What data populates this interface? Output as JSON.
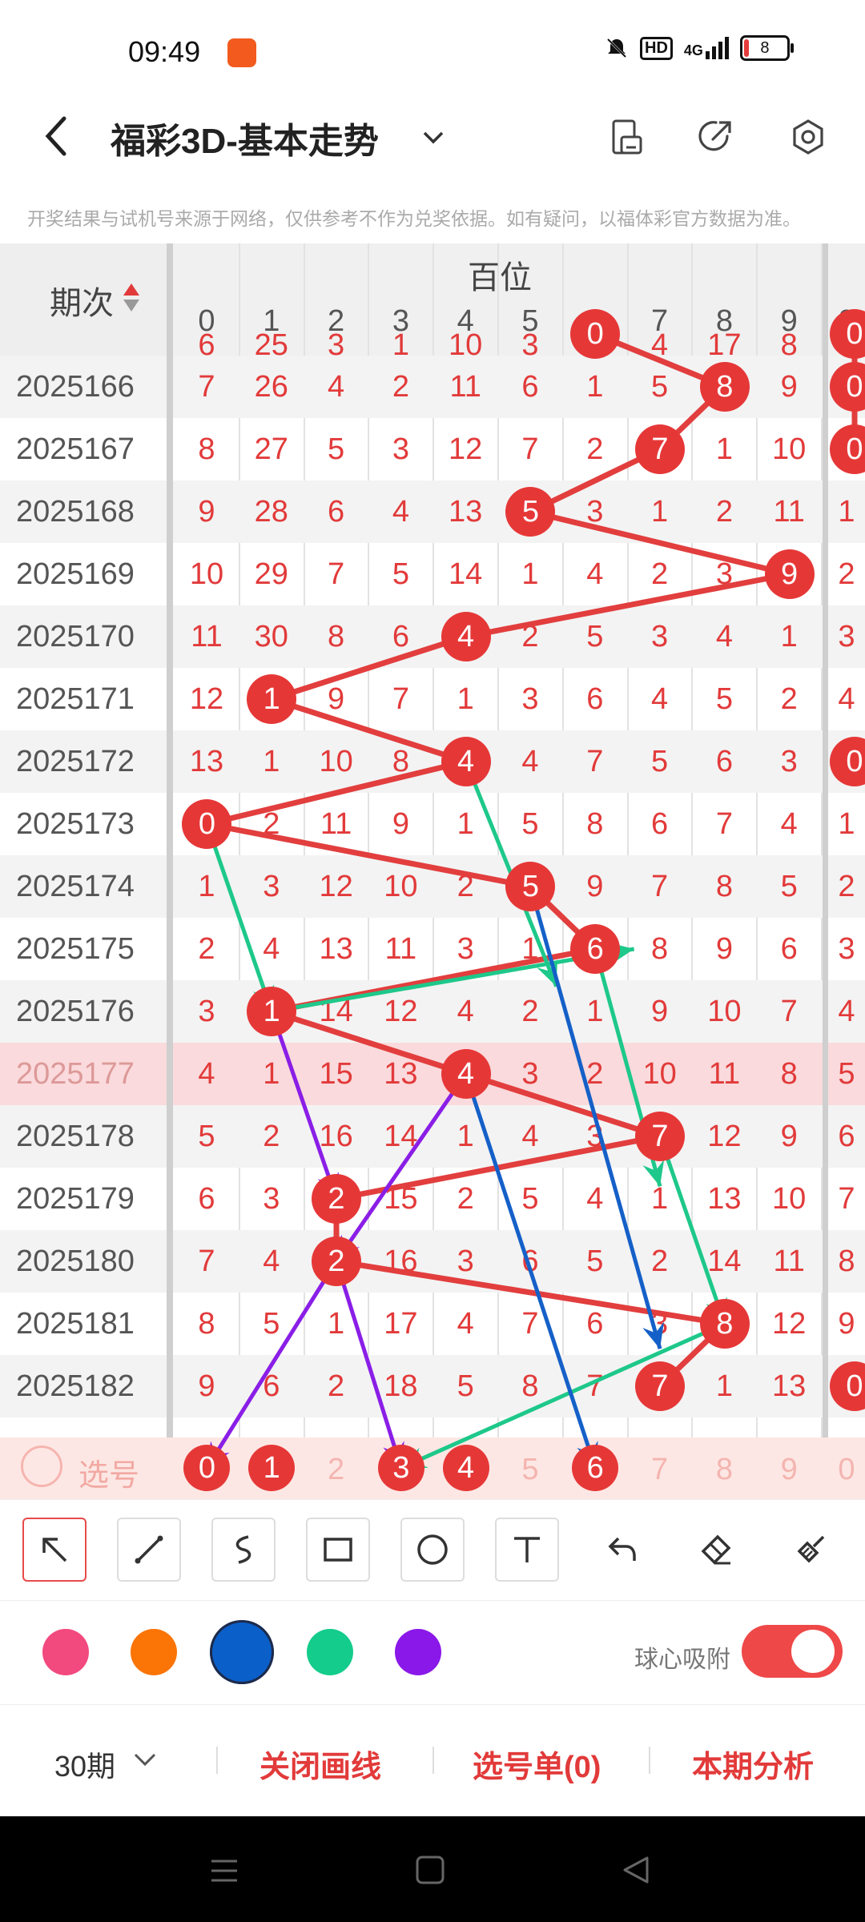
{
  "status": {
    "time": "09:49",
    "network": "4G",
    "hd": "HD",
    "battery": "8"
  },
  "header": {
    "title": "福彩3D-基本走势"
  },
  "disclaimer": "开奖结果与试机号来源于网络，仅供参考不作为兑奖依据。如有疑问，以福体彩官方数据为准。",
  "table": {
    "period_header": "期次",
    "group_header": "百位",
    "digits": [
      "0",
      "1",
      "2",
      "3",
      "4",
      "5",
      "6",
      "7",
      "8",
      "9"
    ],
    "next_col_digit": "0",
    "partial_row": [
      "6",
      "25",
      "3",
      "1",
      "10",
      "3",
      "0",
      "4",
      "17",
      "8"
    ],
    "rows": [
      {
        "period": "2025166",
        "cells": [
          "7",
          "26",
          "4",
          "2",
          "11",
          "6",
          "1",
          "5",
          "8",
          "9"
        ],
        "win": 8,
        "next": "0",
        "next_ball": true
      },
      {
        "period": "2025167",
        "cells": [
          "8",
          "27",
          "5",
          "3",
          "12",
          "7",
          "2",
          "7",
          "1",
          "10"
        ],
        "win": 7,
        "next": "0",
        "next_ball": true
      },
      {
        "period": "2025168",
        "cells": [
          "9",
          "28",
          "6",
          "4",
          "13",
          "5",
          "3",
          "1",
          "2",
          "11"
        ],
        "win": 5,
        "next": "1",
        "next_ball": false
      },
      {
        "period": "2025169",
        "cells": [
          "10",
          "29",
          "7",
          "5",
          "14",
          "1",
          "4",
          "2",
          "3",
          "9"
        ],
        "win": 9,
        "next": "2",
        "next_ball": false
      },
      {
        "period": "2025170",
        "cells": [
          "11",
          "30",
          "8",
          "6",
          "4",
          "2",
          "5",
          "3",
          "4",
          "1"
        ],
        "win": 4,
        "next": "3",
        "next_ball": false
      },
      {
        "period": "2025171",
        "cells": [
          "12",
          "1",
          "9",
          "7",
          "1",
          "3",
          "6",
          "4",
          "5",
          "2"
        ],
        "win": 1,
        "next": "4",
        "next_ball": false
      },
      {
        "period": "2025172",
        "cells": [
          "13",
          "1",
          "10",
          "8",
          "4",
          "4",
          "7",
          "5",
          "6",
          "3"
        ],
        "win": 4,
        "next": "0",
        "next_ball": true
      },
      {
        "period": "2025173",
        "cells": [
          "0",
          "2",
          "11",
          "9",
          "1",
          "5",
          "8",
          "6",
          "7",
          "4"
        ],
        "win": 0,
        "next": "1",
        "next_ball": false
      },
      {
        "period": "2025174",
        "cells": [
          "1",
          "3",
          "12",
          "10",
          "2",
          "5",
          "9",
          "7",
          "8",
          "5"
        ],
        "win": 5,
        "next": "2",
        "next_ball": false
      },
      {
        "period": "2025175",
        "cells": [
          "2",
          "4",
          "13",
          "11",
          "3",
          "1",
          "6",
          "8",
          "9",
          "6"
        ],
        "win": 6,
        "next": "3",
        "next_ball": false
      },
      {
        "period": "2025176",
        "cells": [
          "3",
          "1",
          "14",
          "12",
          "4",
          "2",
          "1",
          "9",
          "10",
          "7"
        ],
        "win": 1,
        "next": "4",
        "next_ball": false
      },
      {
        "period": "2025177",
        "cells": [
          "4",
          "1",
          "15",
          "13",
          "4",
          "3",
          "2",
          "10",
          "11",
          "8"
        ],
        "win": 4,
        "next": "5",
        "next_ball": false,
        "highlight": true
      },
      {
        "period": "2025178",
        "cells": [
          "5",
          "2",
          "16",
          "14",
          "1",
          "4",
          "3",
          "7",
          "12",
          "9"
        ],
        "win": 7,
        "next": "6",
        "next_ball": false
      },
      {
        "period": "2025179",
        "cells": [
          "6",
          "3",
          "2",
          "15",
          "2",
          "5",
          "4",
          "1",
          "13",
          "10"
        ],
        "win": 2,
        "next": "7",
        "next_ball": false
      },
      {
        "period": "2025180",
        "cells": [
          "7",
          "4",
          "2",
          "16",
          "3",
          "6",
          "5",
          "2",
          "14",
          "11"
        ],
        "win": 2,
        "next": "8",
        "next_ball": false
      },
      {
        "period": "2025181",
        "cells": [
          "8",
          "5",
          "1",
          "17",
          "4",
          "7",
          "6",
          "3",
          "8",
          "12"
        ],
        "win": 8,
        "next": "9",
        "next_ball": false
      },
      {
        "period": "2025182",
        "cells": [
          "9",
          "6",
          "2",
          "18",
          "5",
          "8",
          "7",
          "7",
          "1",
          "13"
        ],
        "win": 7,
        "next": "0",
        "next_ball": true
      }
    ],
    "select_row": {
      "label": "选号",
      "cells": [
        {
          "d": "0",
          "selected": true
        },
        {
          "d": "1",
          "selected": true
        },
        {
          "d": "2",
          "selected": false
        },
        {
          "d": "3",
          "selected": true
        },
        {
          "d": "4",
          "selected": true
        },
        {
          "d": "5",
          "selected": false
        },
        {
          "d": "6",
          "selected": true
        },
        {
          "d": "7",
          "selected": false
        },
        {
          "d": "8",
          "selected": false
        },
        {
          "d": "9",
          "selected": false
        }
      ],
      "next": "0"
    }
  },
  "drawing": {
    "colors": {
      "red": "#e23e3e",
      "green": "#1ec88a",
      "purple": "#8a1ee6",
      "blue": "#1560c8"
    },
    "lines": [
      {
        "color": "green",
        "from": [
          4,
          6
        ],
        "to": [
          5.4,
          9.6
        ]
      },
      {
        "color": "green",
        "from": [
          0,
          7
        ],
        "to": [
          1,
          10
        ]
      },
      {
        "color": "green",
        "from": [
          1,
          10
        ],
        "to": [
          6.6,
          9
        ]
      },
      {
        "color": "green",
        "from": [
          6,
          9
        ],
        "to": [
          7,
          12.8
        ]
      },
      {
        "color": "green",
        "from": [
          7,
          12
        ],
        "to": [
          8,
          15
        ]
      },
      {
        "color": "green",
        "from": [
          8,
          15
        ],
        "to": [
          3,
          17
        ]
      },
      {
        "color": "purple",
        "from": [
          1,
          10
        ],
        "to": [
          2,
          13
        ]
      },
      {
        "color": "purple",
        "from": [
          4,
          11
        ],
        "to": [
          2,
          14
        ]
      },
      {
        "color": "purple",
        "from": [
          2,
          14
        ],
        "to": [
          0,
          17
        ]
      },
      {
        "color": "purple",
        "from": [
          2,
          14
        ],
        "to": [
          3,
          17
        ]
      },
      {
        "color": "blue",
        "from": [
          5,
          8
        ],
        "to": [
          7,
          15.4
        ]
      },
      {
        "color": "blue",
        "from": [
          4,
          11
        ],
        "to": [
          6,
          17
        ]
      }
    ]
  },
  "tools": [
    "pointer-tool",
    "line-tool",
    "curve-tool",
    "rectangle-tool",
    "circle-tool",
    "text-tool",
    "undo",
    "eraser",
    "clear-brush"
  ],
  "palette": {
    "colors": [
      "#f2497f",
      "#fa7406",
      "#0b5fc9",
      "#14cc8c",
      "#8a18e8"
    ],
    "selected_index": 2,
    "snap_label": "球心吸附",
    "snap_on": true
  },
  "bottom": {
    "periods": "30期",
    "close_lines": "关闭画线",
    "pick_list": "选号单(0)",
    "analysis": "本期分析"
  }
}
